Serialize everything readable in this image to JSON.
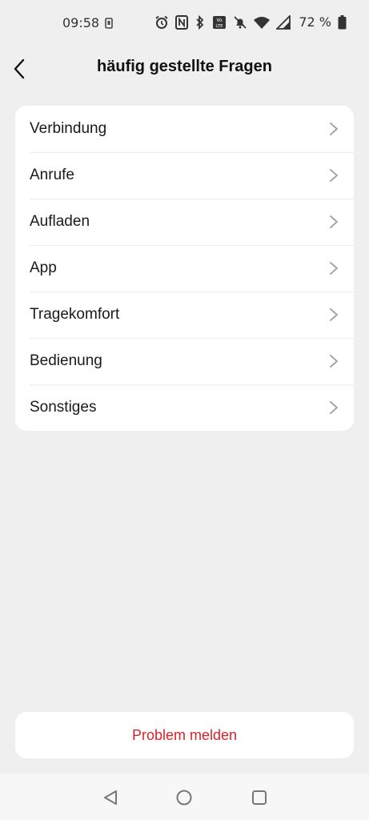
{
  "status_bar": {
    "time": "09:58",
    "battery_percent": "72 %",
    "icons": [
      "notification-icon",
      "alarm-icon",
      "nfc-icon",
      "bluetooth-icon",
      "volte-icon",
      "mute-icon",
      "wifi-icon",
      "signal-icon",
      "battery-icon"
    ]
  },
  "header": {
    "title": "häufig gestellte Fragen",
    "back_icon": "back-arrow-icon"
  },
  "faq": {
    "items": [
      {
        "label": "Verbindung"
      },
      {
        "label": "Anrufe"
      },
      {
        "label": "Aufladen"
      },
      {
        "label": "App"
      },
      {
        "label": "Tragekomfort"
      },
      {
        "label": "Bedienung"
      },
      {
        "label": "Sonstiges"
      }
    ]
  },
  "report": {
    "label": "Problem melden",
    "color": "#d9232a"
  },
  "navigation": {
    "buttons": [
      "back-nav-icon",
      "home-nav-icon",
      "recents-nav-icon"
    ]
  }
}
